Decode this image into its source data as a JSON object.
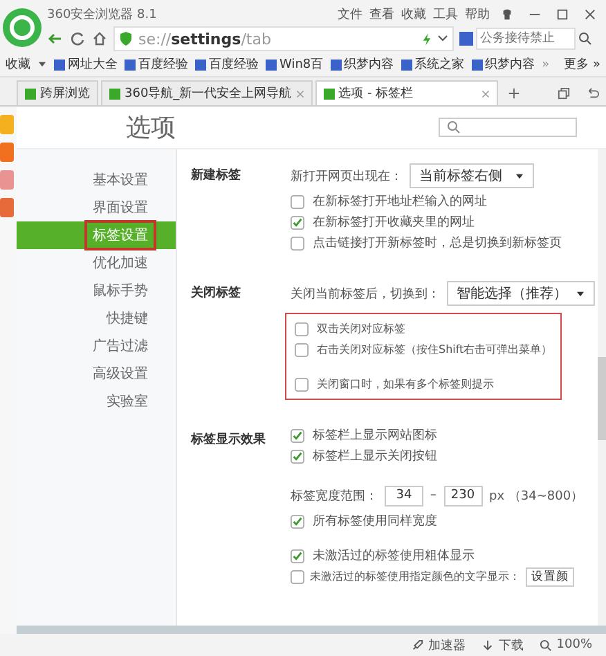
{
  "window": {
    "title": "360安全浏览器 8.1",
    "menu": [
      "文件",
      "查看",
      "收藏",
      "工具",
      "帮助"
    ]
  },
  "address_bar": {
    "url_scheme": "se://",
    "url_host": "settings",
    "url_path": "/tab",
    "search_placeholder": "公务接待禁止"
  },
  "bookmarks": {
    "label": "收藏",
    "items": [
      "网址大全",
      "百度经验",
      "百度经验",
      "Win8百",
      "织梦内容",
      "系统之家",
      "织梦内容"
    ],
    "overflow": "»",
    "more": "更多 »"
  },
  "tabs": [
    {
      "label": "跨屏浏览",
      "selected": false,
      "closable": false
    },
    {
      "label": "360导航_新一代安全上网导航",
      "selected": false,
      "closable": true
    },
    {
      "label": "选项 - 标签栏",
      "selected": true,
      "closable": true
    }
  ],
  "page": {
    "title": "选项",
    "nav": [
      {
        "label": "基本设置",
        "selected": false,
        "highlighted": false
      },
      {
        "label": "界面设置",
        "selected": false,
        "highlighted": false
      },
      {
        "label": "标签设置",
        "selected": true,
        "highlighted": true
      },
      {
        "label": "优化加速",
        "selected": false,
        "highlighted": false
      },
      {
        "label": "鼠标手势",
        "selected": false,
        "highlighted": false
      },
      {
        "label": "快捷键",
        "selected": false,
        "highlighted": false
      },
      {
        "label": "广告过滤",
        "selected": false,
        "highlighted": false
      },
      {
        "label": "高级设置",
        "selected": false,
        "highlighted": false
      },
      {
        "label": "实验室",
        "selected": false,
        "highlighted": false
      }
    ],
    "sections": [
      {
        "title": "新建标签",
        "items": [
          {
            "kind": "select",
            "label": "新打开网页出现在：",
            "value": "当前标签右侧"
          },
          {
            "kind": "checkbox",
            "label": "在新标签打开地址栏输入的网址",
            "checked": false
          },
          {
            "kind": "checkbox",
            "label": "在新标签打开收藏夹里的网址",
            "checked": true
          },
          {
            "kind": "checkbox",
            "label": "点击链接打开新标签时，总是切换到新标签页",
            "checked": false
          }
        ]
      },
      {
        "title": "关闭标签",
        "items": [
          {
            "kind": "select",
            "label": "关闭当前标签后，切换到：",
            "value": "智能选择（推荐）"
          },
          {
            "kind": "highlight_group",
            "items": [
              {
                "kind": "checkbox",
                "label": "双击关闭对应标签",
                "checked": false
              },
              {
                "kind": "checkbox",
                "label": "右击关闭对应标签（按住Shift右击可弹出菜单）",
                "checked": false
              },
              {
                "kind": "spacer"
              },
              {
                "kind": "checkbox",
                "label": "关闭窗口时，如果有多个标签则提示",
                "checked": false
              }
            ]
          }
        ]
      },
      {
        "title": "标签显示效果",
        "items": [
          {
            "kind": "checkbox",
            "label": "标签栏上显示网站图标",
            "checked": true
          },
          {
            "kind": "checkbox",
            "label": "标签栏上显示关闭按钮",
            "checked": true
          },
          {
            "kind": "spacer"
          },
          {
            "kind": "range",
            "label": "标签宽度范围：",
            "min": "34",
            "separator": "–",
            "max": "230",
            "unit": "px （34~800）"
          },
          {
            "kind": "checkbox",
            "label": "所有标签使用同样宽度",
            "checked": true
          },
          {
            "kind": "spacer"
          },
          {
            "kind": "checkbox",
            "label": "未激活过的标签使用粗体显示",
            "checked": true
          },
          {
            "kind": "checkbox_button",
            "label": "未激活过的标签使用指定颜色的文字显示：",
            "checked": false,
            "button": "设置颜"
          }
        ]
      }
    ]
  },
  "status_bar": {
    "accelerator": "加速器",
    "download": "下载",
    "zoom": "100%"
  }
}
